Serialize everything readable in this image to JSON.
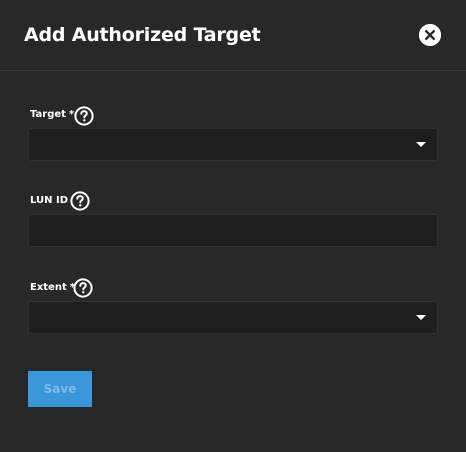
{
  "dialog": {
    "title": "Add Authorized Target",
    "close_icon": "close-circle-icon"
  },
  "form": {
    "target": {
      "label": "Target",
      "required_mark": "*",
      "help_icon": "help-circle-icon",
      "value": ""
    },
    "lun_id": {
      "label": "LUN ID",
      "help_icon": "help-circle-icon",
      "value": ""
    },
    "extent": {
      "label": "Extent",
      "required_mark": "*",
      "help_icon": "help-circle-icon",
      "value": ""
    }
  },
  "actions": {
    "save_label": "Save",
    "save_enabled": false
  },
  "colors": {
    "background": "#282828",
    "field_background": "#1e1e1e",
    "primary": "#3a97d9"
  }
}
